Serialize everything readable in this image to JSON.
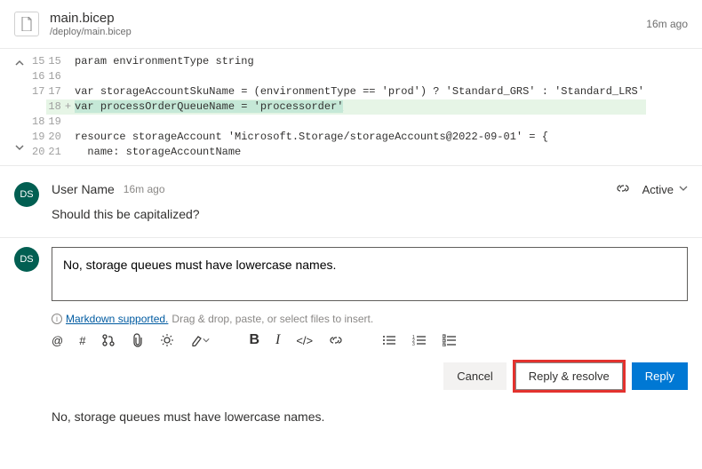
{
  "file": {
    "name": "main.bicep",
    "path": "/deploy/main.bicep",
    "time": "16m ago"
  },
  "diff": {
    "lines": [
      {
        "old": "15",
        "new": "15",
        "op": " ",
        "code": "param environmentType string",
        "added": false
      },
      {
        "old": "16",
        "new": "16",
        "op": " ",
        "code": "",
        "added": false
      },
      {
        "old": "17",
        "new": "17",
        "op": " ",
        "code": "var storageAccountSkuName = (environmentType == 'prod') ? 'Standard_GRS' : 'Standard_LRS'",
        "added": false
      },
      {
        "old": "",
        "new": "18",
        "op": "+",
        "code_prefix": "",
        "code_hl": "var processOrderQueueName = 'processorder'",
        "added": true
      },
      {
        "old": "18",
        "new": "19",
        "op": " ",
        "code": "",
        "added": false
      },
      {
        "old": "19",
        "new": "20",
        "op": " ",
        "code": "resource storageAccount 'Microsoft.Storage/storageAccounts@2022-09-01' = {",
        "added": false
      },
      {
        "old": "20",
        "new": "21",
        "op": " ",
        "code": "  name: storageAccountName",
        "added": false
      }
    ]
  },
  "comment": {
    "avatar": "DS",
    "user": "User Name",
    "time": "16m ago",
    "status": "Active",
    "body": "Should this be capitalized?"
  },
  "reply": {
    "avatar": "DS",
    "value": "No, storage queues must have lowercase names.",
    "md_link": "Markdown supported.",
    "md_rest": "Drag & drop, paste, or select files to insert.",
    "preview": "No, storage queues must have lowercase names."
  },
  "buttons": {
    "cancel": "Cancel",
    "resolve": "Reply & resolve",
    "reply": "Reply"
  }
}
